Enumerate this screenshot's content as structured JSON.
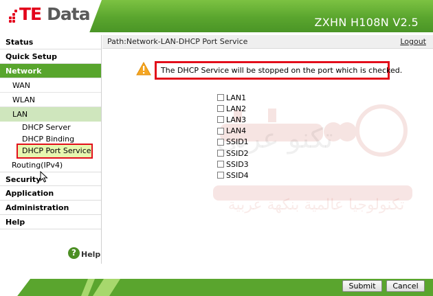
{
  "header": {
    "logo_te": "TE",
    "logo_data": "Data",
    "model": "ZXHN H108N V2.5"
  },
  "nav": {
    "status": "Status",
    "quick_setup": "Quick Setup",
    "network": "Network",
    "wan": "WAN",
    "wlan": "WLAN",
    "lan": "LAN",
    "dhcp_server": "DHCP Server",
    "dhcp_binding": "DHCP Binding",
    "dhcp_port_service": "DHCP Port Service",
    "routing": "Routing(IPv4)",
    "security": "Security",
    "application": "Application",
    "administration": "Administration",
    "help": "Help",
    "help_link": "Help",
    "help_icon_glyph": "?"
  },
  "main": {
    "path": "Path:Network-LAN-DHCP Port Service",
    "logout": "Logout",
    "notice": "The DHCP Service will be stopped on the port which is checked.",
    "ports": [
      {
        "label": "LAN1",
        "checked": false
      },
      {
        "label": "LAN2",
        "checked": false
      },
      {
        "label": "LAN3",
        "checked": false
      },
      {
        "label": "LAN4",
        "checked": false
      },
      {
        "label": "SSID1",
        "checked": false
      },
      {
        "label": "SSID2",
        "checked": false
      },
      {
        "label": "SSID3",
        "checked": false
      },
      {
        "label": "SSID4",
        "checked": false
      }
    ]
  },
  "footer": {
    "submit": "Submit",
    "cancel": "Cancel"
  },
  "watermark": {
    "text_line1": "تكنو عربي",
    "text_line2": "تكنولوجيا عالمية بنكهة عربية"
  },
  "colors": {
    "brand_green": "#58a52d",
    "brand_red": "#e3001b",
    "highlight_red": "#e20d1a"
  },
  "icons": {
    "warning": "warning-triangle-icon",
    "help": "help-icon",
    "cursor": "mouse-cursor-icon"
  }
}
